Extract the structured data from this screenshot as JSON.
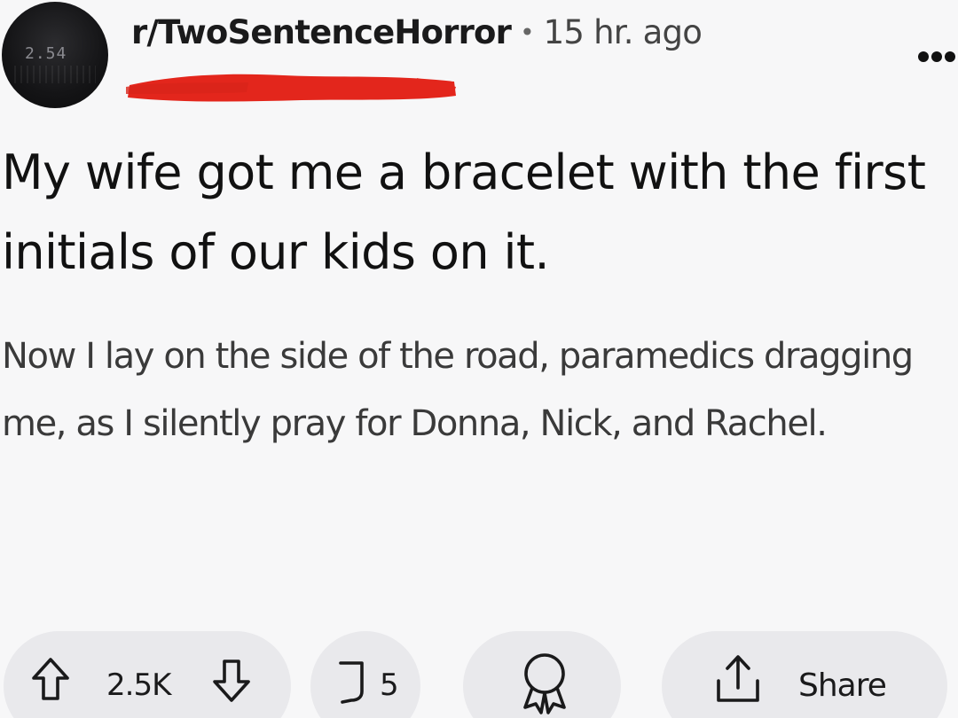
{
  "header": {
    "subreddit": "r/TwoSentenceHorror",
    "separator": "•",
    "time": "15 hr. ago",
    "avatar_text": "2.54"
  },
  "post": {
    "title": "My wife got me a bracelet with the first initials of our kids on it.",
    "body": "Now I lay on the side of the road, paramedics dragging me, as I silently pray for Donna, Nick, and Rachel."
  },
  "actions": {
    "votes": "2.5K",
    "comments": "5",
    "share": "Share"
  },
  "colors": {
    "redaction": "#e3261c",
    "background": "#f7f7f8",
    "pill": "#e9e9ec"
  },
  "icons": [
    "upvote-icon",
    "downvote-icon",
    "comment-icon",
    "award-icon",
    "share-icon",
    "more-options-icon"
  ]
}
